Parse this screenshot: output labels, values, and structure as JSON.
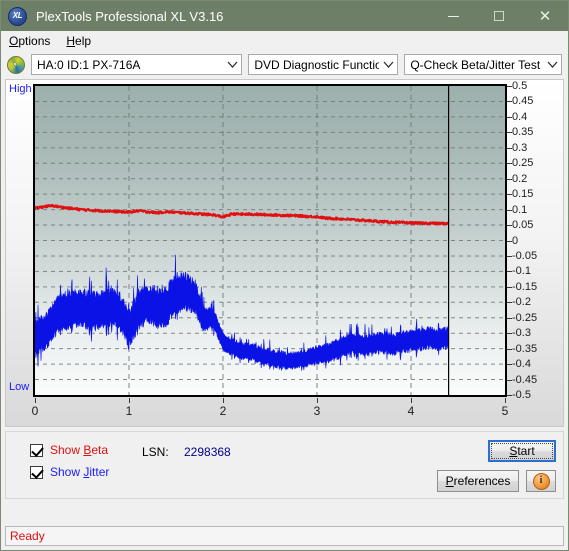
{
  "window": {
    "title": "PlexTools Professional XL V3.16",
    "icon": "xl-app-icon",
    "controls": {
      "minimize": "minimize-icon",
      "maximize": "maximize-icon",
      "close": "close-icon"
    },
    "titlebar_color": "#6d8067"
  },
  "menu": {
    "items": [
      {
        "label": "Options",
        "accel": "O"
      },
      {
        "label": "Help",
        "accel": "H"
      }
    ]
  },
  "toolbar": {
    "disc_icon": "disc-icon",
    "drive_select": {
      "value": "HA:0 ID:1  PX-716A",
      "caret": "chevron-down-icon"
    },
    "function_select": {
      "value": "DVD Diagnostic Functions",
      "caret": "chevron-down-icon"
    },
    "test_select": {
      "value": "Q-Check Beta/Jitter Test",
      "caret": "chevron-down-icon"
    }
  },
  "chart_data": {
    "type": "line",
    "title": "Q-Check Beta/Jitter Test",
    "xlabel": "",
    "ylabel": "",
    "high_label": "High",
    "low_label": "Low",
    "xlim": [
      0,
      5
    ],
    "ylim": [
      -0.5,
      0.5
    ],
    "xticks": [
      0,
      1,
      2,
      3,
      4,
      5
    ],
    "yticks": [
      0.5,
      0.45,
      0.4,
      0.35,
      0.3,
      0.25,
      0.2,
      0.15,
      0.1,
      0.05,
      0,
      -0.05,
      -0.1,
      -0.15,
      -0.2,
      -0.25,
      -0.3,
      -0.35,
      -0.4,
      -0.45,
      -0.5
    ],
    "ytick_labels": [
      "0.5",
      "0.45",
      "0.4",
      "0.35",
      "0.3",
      "0.25",
      "0.2",
      "0.15",
      "0.1",
      "0.05",
      "0",
      "-0.05",
      "-0.1",
      "-0.15",
      "-0.2",
      "-0.25",
      "-0.3",
      "-0.35",
      "-0.4",
      "-0.45",
      "-0.5"
    ],
    "grid": true,
    "grid_style": "dashed",
    "grid_color": "#6e7a78",
    "data_end_marker_x": 4.4,
    "legend_position": "below-chart",
    "series": [
      {
        "name": "Beta",
        "color": "#e01010",
        "visible": true,
        "x": [
          0.0,
          0.1,
          0.2,
          0.3,
          0.4,
          0.5,
          0.6,
          0.7,
          0.8,
          0.9,
          1.0,
          1.1,
          1.2,
          1.3,
          1.4,
          1.5,
          1.6,
          1.7,
          1.8,
          1.9,
          2.0,
          2.1,
          2.2,
          2.3,
          2.4,
          2.5,
          2.6,
          2.7,
          2.8,
          2.9,
          3.0,
          3.1,
          3.2,
          3.3,
          3.4,
          3.5,
          3.6,
          3.7,
          3.8,
          3.9,
          4.0,
          4.1,
          4.2,
          4.3,
          4.4
        ],
        "values": [
          0.104,
          0.11,
          0.112,
          0.107,
          0.103,
          0.1,
          0.098,
          0.096,
          0.095,
          0.093,
          0.092,
          0.096,
          0.093,
          0.09,
          0.093,
          0.091,
          0.089,
          0.087,
          0.085,
          0.083,
          0.076,
          0.086,
          0.085,
          0.085,
          0.084,
          0.083,
          0.082,
          0.081,
          0.08,
          0.078,
          0.077,
          0.072,
          0.071,
          0.069,
          0.067,
          0.065,
          0.063,
          0.061,
          0.059,
          0.058,
          0.057,
          0.056,
          0.056,
          0.055,
          0.055
        ]
      },
      {
        "name": "Jitter",
        "color": "#0a12e6",
        "visible": true,
        "x": [
          0.0,
          0.1,
          0.2,
          0.3,
          0.4,
          0.5,
          0.6,
          0.7,
          0.8,
          0.9,
          1.0,
          1.1,
          1.2,
          1.3,
          1.4,
          1.5,
          1.6,
          1.7,
          1.8,
          1.9,
          2.0,
          2.1,
          2.2,
          2.3,
          2.4,
          2.5,
          2.6,
          2.7,
          2.8,
          2.9,
          3.0,
          3.1,
          3.2,
          3.3,
          3.4,
          3.5,
          3.6,
          3.7,
          3.8,
          3.9,
          4.0,
          4.1,
          4.2,
          4.3,
          4.4
        ],
        "values": [
          -0.32,
          -0.3,
          -0.255,
          -0.225,
          -0.22,
          -0.215,
          -0.23,
          -0.225,
          -0.215,
          -0.225,
          -0.29,
          -0.225,
          -0.205,
          -0.215,
          -0.21,
          -0.175,
          -0.165,
          -0.18,
          -0.255,
          -0.25,
          -0.33,
          -0.345,
          -0.355,
          -0.36,
          -0.37,
          -0.38,
          -0.385,
          -0.39,
          -0.385,
          -0.38,
          -0.37,
          -0.365,
          -0.355,
          -0.34,
          -0.335,
          -0.34,
          -0.335,
          -0.33,
          -0.335,
          -0.33,
          -0.325,
          -0.32,
          -0.315,
          -0.32,
          -0.315
        ],
        "band": [
          0.055,
          0.055,
          0.055,
          0.06,
          0.055,
          0.055,
          0.06,
          0.055,
          0.055,
          0.055,
          0.055,
          0.06,
          0.055,
          0.06,
          0.06,
          0.06,
          0.055,
          0.05,
          0.035,
          0.03,
          0.028,
          0.025,
          0.025,
          0.025,
          0.025,
          0.025,
          0.025,
          0.025,
          0.025,
          0.025,
          0.028,
          0.028,
          0.03,
          0.03,
          0.03,
          0.03,
          0.03,
          0.032,
          0.032,
          0.032,
          0.032,
          0.032,
          0.032,
          0.032,
          0.032
        ]
      }
    ]
  },
  "controls": {
    "show_beta": {
      "label_pre": "Show ",
      "label_accel": "B",
      "label_post": "eta",
      "checked": true,
      "color": "#e01010"
    },
    "show_jitter": {
      "label_pre": "Show ",
      "label_accel": "J",
      "label_post": "itter",
      "checked": true,
      "color": "#1a1aff"
    },
    "lsn_label": "LSN:",
    "lsn_value": "2298368",
    "start_button": {
      "pre": "",
      "accel": "S",
      "post": "tart"
    },
    "preferences_button": {
      "pre": "",
      "accel": "P",
      "post": "references"
    },
    "info_button": "info-icon"
  },
  "status": {
    "text": "Ready"
  }
}
